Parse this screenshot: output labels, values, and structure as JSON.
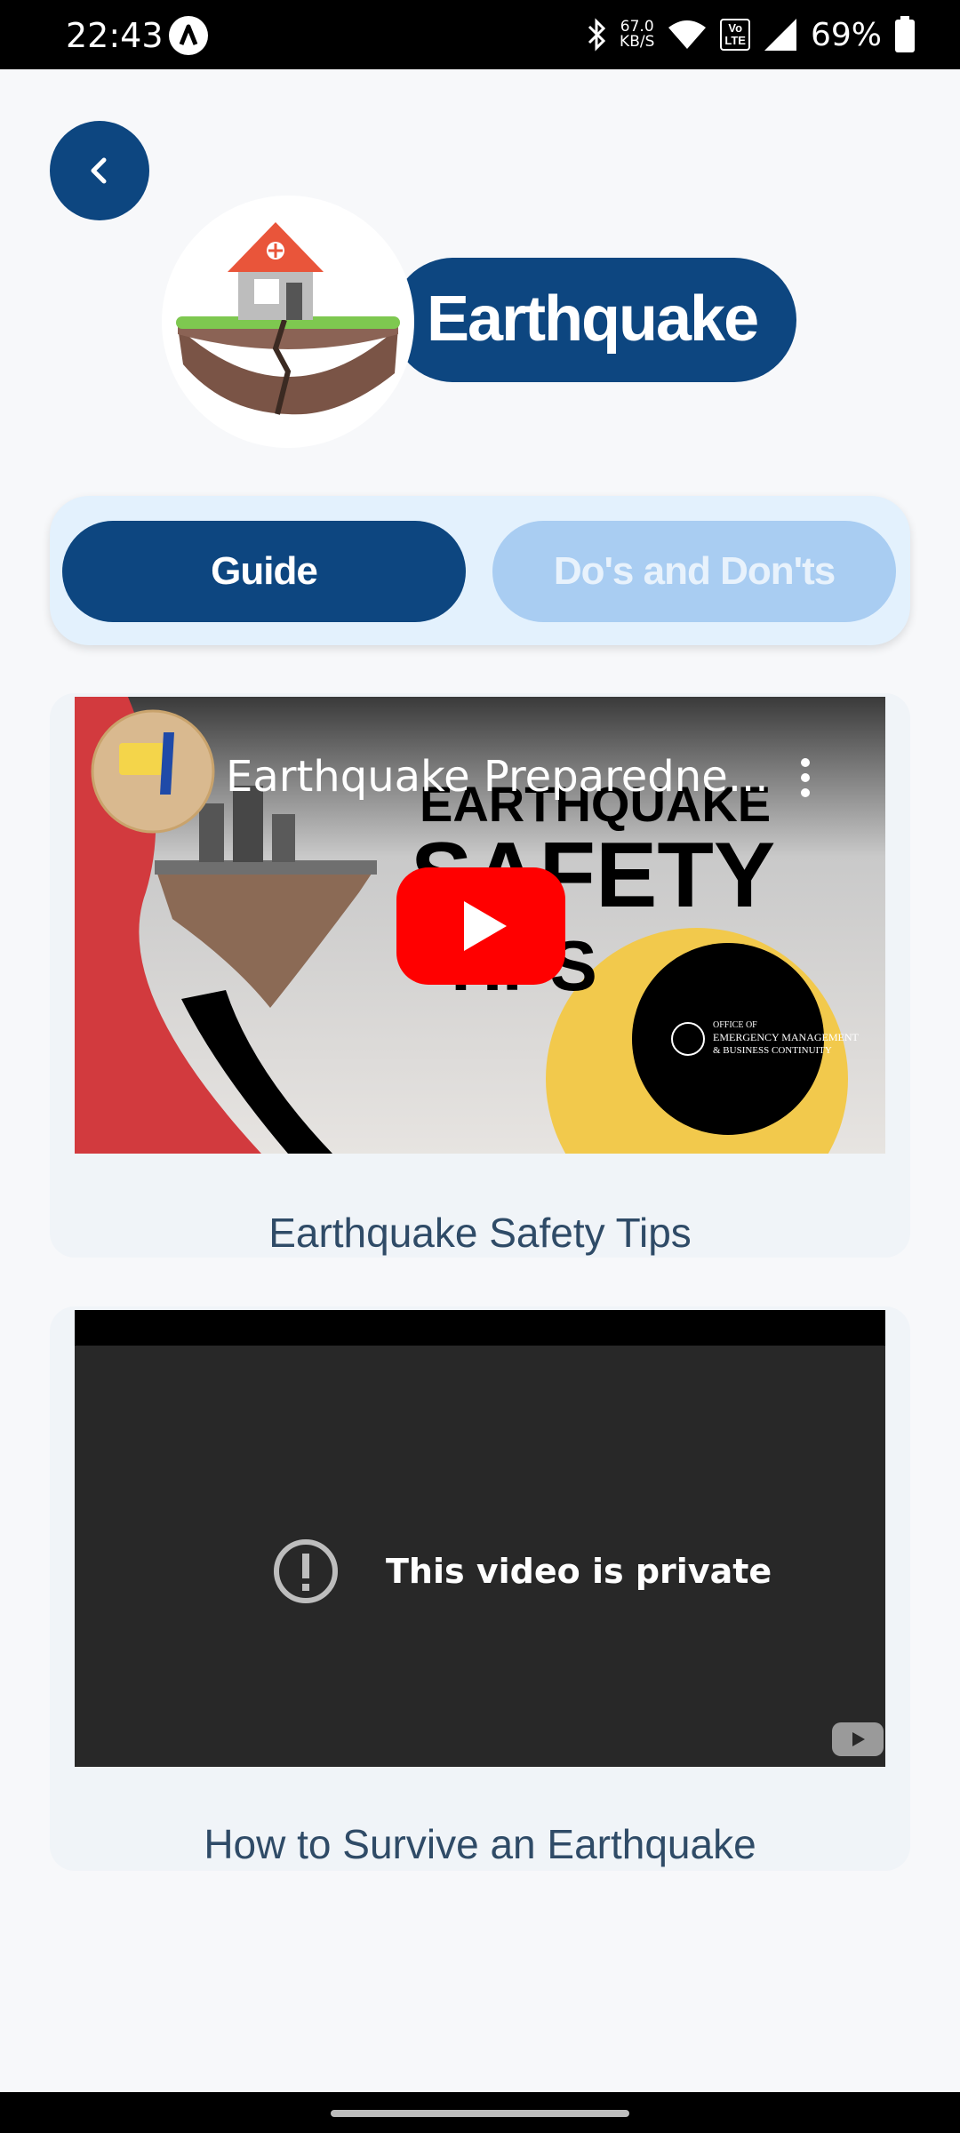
{
  "status_bar": {
    "time": "22:43",
    "net_speed_value": "67.0",
    "net_speed_unit": "KB/S",
    "volte_top": "Vo",
    "volte_bottom": "LTE",
    "battery": "69%"
  },
  "header": {
    "title": "Earthquake"
  },
  "tabs": [
    {
      "label": "Guide",
      "active": true
    },
    {
      "label": "Do's and Don'ts",
      "active": false
    }
  ],
  "videos": [
    {
      "player_title": "Earthquake Preparedne...",
      "thumbnail_heading_1": "EARTHQUAKE",
      "thumbnail_heading_2": "SAFETY",
      "thumbnail_heading_3": "TIPS",
      "thumbnail_org_1": "OFFICE OF",
      "thumbnail_org_2": "EMERGENCY MANAGEMENT",
      "thumbnail_org_3": "& BUSINESS CONTINUITY",
      "caption": "Earthquake Safety Tips"
    },
    {
      "private_message": "This video is private",
      "caption": "How to Survive an Earthquake"
    }
  ],
  "colors": {
    "primary": "#0d4680",
    "tab_inactive": "#a9cdf2",
    "page_bg": "#f7f8fa"
  },
  "icons": {
    "back": "chevron-left-icon",
    "play": "youtube-play-icon",
    "more": "more-vertical-icon",
    "private": "alert-circle-icon"
  }
}
